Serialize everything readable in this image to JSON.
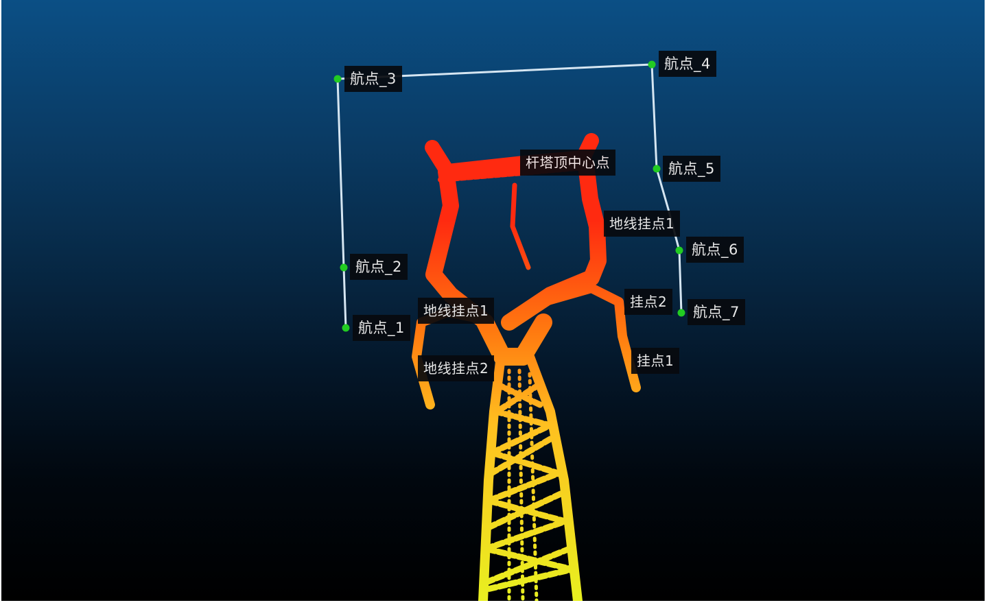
{
  "viewer": {
    "background_top": "#0b4f85",
    "background_bottom": "#000000",
    "flight_path_color": "#d6e6f2",
    "waypoint_color": "#22cc22",
    "tower_gradient": [
      "#ff2a10",
      "#ff7a10",
      "#ffc020",
      "#e8f020"
    ]
  },
  "waypoints": [
    {
      "id": "wp1",
      "label": "航点_1"
    },
    {
      "id": "wp2",
      "label": "航点_2"
    },
    {
      "id": "wp3",
      "label": "航点_3"
    },
    {
      "id": "wp4",
      "label": "航点_4"
    },
    {
      "id": "wp5",
      "label": "航点_5"
    },
    {
      "id": "wp6",
      "label": "航点_6"
    },
    {
      "id": "wp7",
      "label": "航点_7"
    }
  ],
  "annotations": {
    "tower_center": "杆塔顶中心点",
    "right_ground_insulator_1": "地线挂点1",
    "left_ground_insulator_1": "地线挂点1",
    "left_ground_insulator_2": "地线挂点2",
    "right_insulator_2": "挂点2",
    "right_insulator_1": "挂点1"
  }
}
